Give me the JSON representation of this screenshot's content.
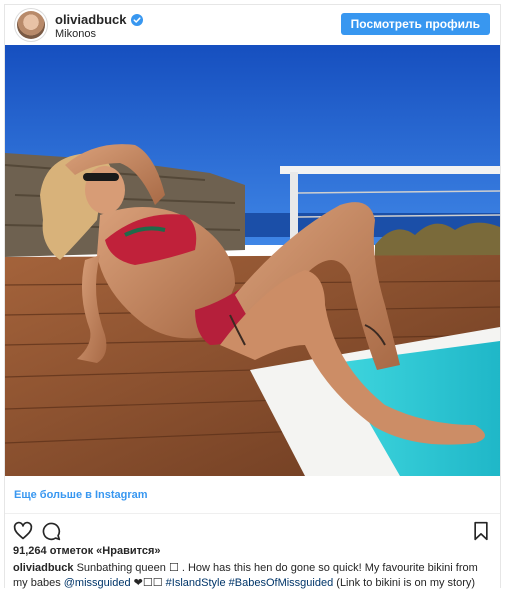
{
  "header": {
    "username": "oliviadbuck",
    "location": "Mikonos",
    "profile_button": "Посмотреть профиль"
  },
  "media": {
    "more_link": "Еще больше в Instagram"
  },
  "actions": {
    "icons": [
      "heart-icon",
      "comment-icon",
      "bookmark-icon"
    ]
  },
  "likes": {
    "text": "91,264 отметок «Нравится»"
  },
  "caption": {
    "username": "oliviadbuck",
    "text_1": "Sunbathing queen ☐ . How has this hen do gone so quick! My favourite bikini from my babes",
    "mention": "@missguided",
    "text_2": "❤☐☐",
    "hashtag_1": "#IslandStyle",
    "hashtag_2": "#BabesOfMissguided",
    "text_3": "(Link to bikini is on my story)"
  },
  "colors": {
    "accent": "#3897f0",
    "link": "#003569",
    "sky": "#1d5fd1",
    "deck": "#8a4e2c",
    "pool": "#2ec6d4"
  }
}
